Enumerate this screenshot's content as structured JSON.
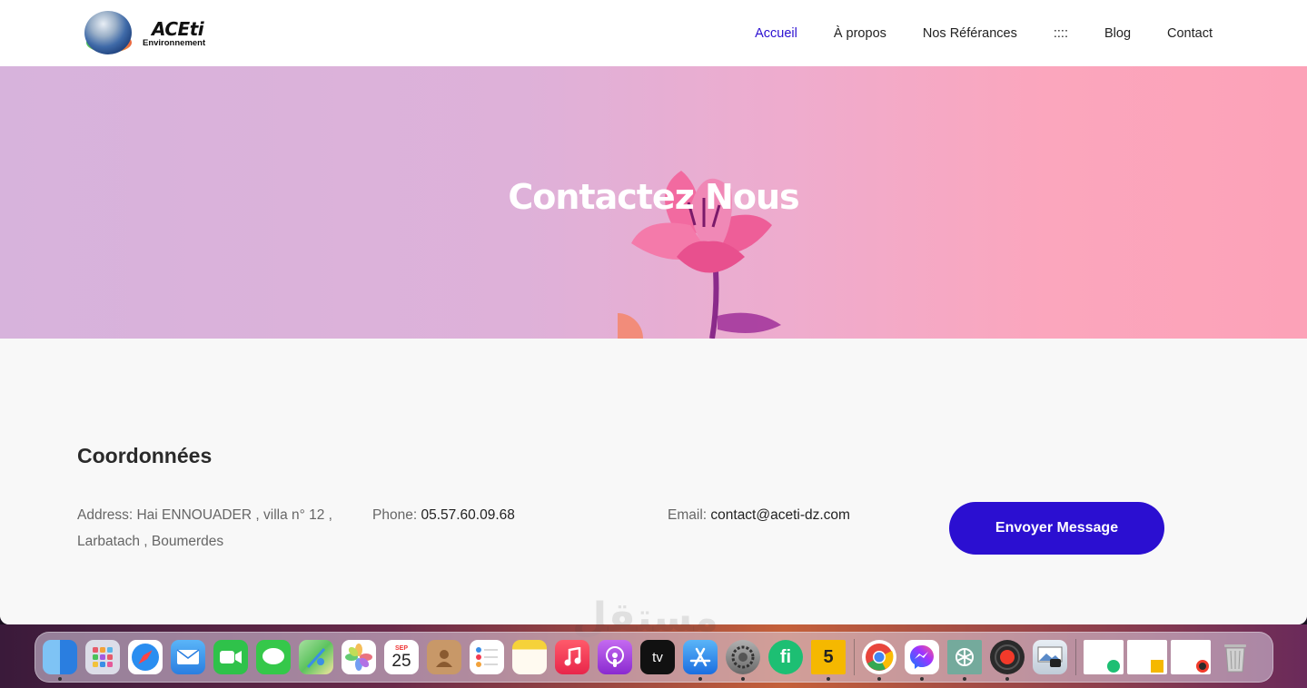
{
  "header": {
    "logo_name": "ACEti",
    "logo_sub": "Environnement",
    "nav": [
      {
        "label": "Accueil",
        "active": true
      },
      {
        "label": "À propos",
        "active": false
      },
      {
        "label": "Nos Référances",
        "active": false
      },
      {
        "label": "::::",
        "active": false
      },
      {
        "label": "Blog",
        "active": false
      },
      {
        "label": "Contact",
        "active": false
      }
    ]
  },
  "hero": {
    "title": "Contactez Nous"
  },
  "content": {
    "section_title": "Coordonnées",
    "address_label": "Address:",
    "address_value": "Hai ENNOUADER , villa n° 12 , Larbatach , Boumerdes",
    "phone_label": "Phone:",
    "phone_value": "05.57.60.09.68",
    "email_label": "Email:",
    "email_value": "contact@aceti-dz.com",
    "button_label": "Envoyer Message"
  },
  "colors": {
    "accent": "#2b0fd1",
    "hero_left": "#d7b3dc",
    "hero_right": "#fca2b8"
  },
  "watermark": "مستقل",
  "dock": {
    "calendar_month": "SEP",
    "calendar_day": "25",
    "tv_label": "tv",
    "fiverr_label": "fi",
    "five_label": "5",
    "apps": [
      {
        "name": "finder-icon",
        "color": "#3a8ee6",
        "running": true
      },
      {
        "name": "launchpad-icon",
        "color": "#e45a8a",
        "running": false
      },
      {
        "name": "safari-icon",
        "color": "#2a8ef0",
        "running": false
      },
      {
        "name": "mail-icon",
        "color": "#3b9cf2",
        "running": false
      },
      {
        "name": "facetime-icon",
        "color": "#2fc24a",
        "running": false
      },
      {
        "name": "messages-icon",
        "color": "#35c84a",
        "running": false
      },
      {
        "name": "maps-icon",
        "color": "#5cc35e",
        "running": false
      },
      {
        "name": "photos-icon",
        "color": "#f5f5f5",
        "running": false
      },
      {
        "name": "calendar-icon",
        "color": "#ffffff",
        "running": false
      },
      {
        "name": "contacts-icon",
        "color": "#b88a5a",
        "running": false
      },
      {
        "name": "reminders-icon",
        "color": "#ffffff",
        "running": false
      },
      {
        "name": "notes-icon",
        "color": "#fff3b0",
        "running": false
      },
      {
        "name": "music-icon",
        "color": "#f23a50",
        "running": false
      },
      {
        "name": "podcasts-icon",
        "color": "#9a3ad8",
        "running": false
      },
      {
        "name": "apple-tv-icon",
        "color": "#111111",
        "running": false
      },
      {
        "name": "app-store-icon",
        "color": "#2a8ef0",
        "running": true
      },
      {
        "name": "system-settings-icon",
        "color": "#8a8a8a",
        "running": true
      },
      {
        "name": "fiverr-icon",
        "color": "#1dbf73",
        "running": false
      },
      {
        "name": "five-app-icon",
        "color": "#f5b800",
        "running": true
      },
      {
        "name": "chrome-icon",
        "color": "#ffffff",
        "running": true
      },
      {
        "name": "messenger-icon",
        "color": "#ffffff",
        "running": true
      },
      {
        "name": "chatgpt-icon",
        "color": "#74aa9c",
        "running": true
      },
      {
        "name": "screen-recorder-icon",
        "color": "#2a2a2a",
        "running": true
      },
      {
        "name": "preview-icon",
        "color": "#e0e8f0",
        "running": true
      }
    ]
  }
}
